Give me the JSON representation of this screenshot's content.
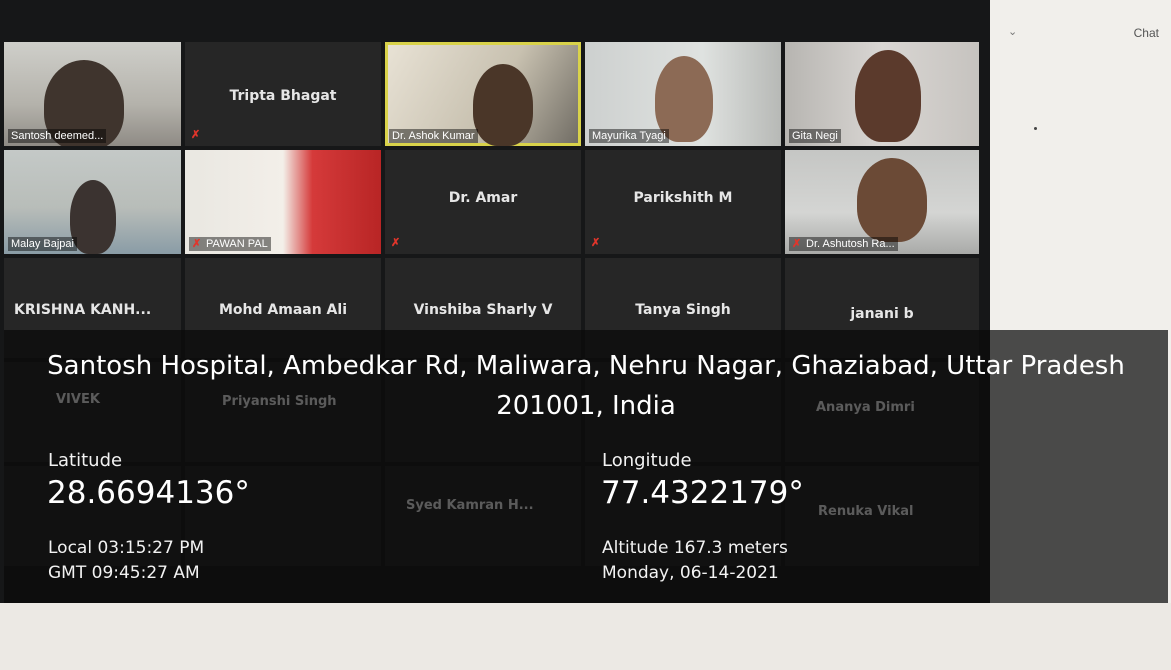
{
  "meeting": {
    "tiles": [
      {
        "name": "Santosh deemed...",
        "type": "video",
        "style": "video-a",
        "muted": false
      },
      {
        "name": "Tripta Bhagat",
        "type": "name",
        "muted": true
      },
      {
        "name": "Dr. Ashok Kumar",
        "type": "video",
        "style": "video-b",
        "active": true,
        "muted": false
      },
      {
        "name": "Mayurika Tyagi",
        "type": "video",
        "style": "video-c",
        "muted": false
      },
      {
        "name": "Gita Negi",
        "type": "video",
        "style": "video-d",
        "muted": false
      },
      {
        "name": "Malay Bajpai",
        "type": "video",
        "style": "video-e",
        "muted": false
      },
      {
        "name": "PAWAN PAL",
        "type": "video",
        "style": "video-f",
        "muted": true
      },
      {
        "name": "Dr. Amar",
        "type": "name",
        "muted": true
      },
      {
        "name": "Parikshith M",
        "type": "name",
        "muted": true
      },
      {
        "name": "Dr. Ashutosh Ra...",
        "type": "video",
        "style": "video-g",
        "muted": true
      },
      {
        "name": "KRISHNA KANH...",
        "type": "name",
        "muted": false
      },
      {
        "name": "Mohd Amaan Ali",
        "type": "name",
        "muted": false
      },
      {
        "name": "Vinshiba Sharly V",
        "type": "name",
        "muted": false
      },
      {
        "name": "Tanya Singh",
        "type": "name",
        "muted": false
      },
      {
        "name": "janani b",
        "type": "name",
        "muted": false
      }
    ],
    "ghost_names": [
      "VIVEK",
      "Priyanshi Singh",
      "Ananya Dimri",
      "Syed Kamran H...",
      "Renuka Vikal"
    ],
    "mic_muted_icon": "mic-muted-icon",
    "active_speaker_color": "#d9d24a"
  },
  "chat": {
    "title": "Chat"
  },
  "gps": {
    "address": "Santosh Hospital, Ambedkar Rd, Maliwara, Nehru Nagar, Ghaziabad, Uttar Pradesh 201001, India",
    "latitude_label": "Latitude",
    "latitude": "28.6694136°",
    "longitude_label": "Longitude",
    "longitude": "77.4322179°",
    "local_time": "Local 03:15:27 PM",
    "gmt_time": "GMT 09:45:27 AM",
    "altitude": "Altitude 167.3 meters",
    "date": "Monday, 06-14-2021"
  }
}
